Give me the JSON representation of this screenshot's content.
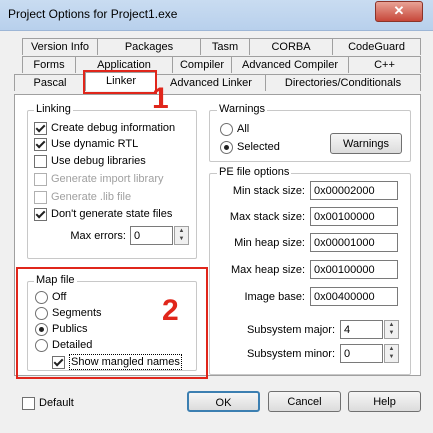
{
  "window": {
    "title": "Project Options for Project1.exe",
    "close_symbol": "✕"
  },
  "tabs": {
    "row1": [
      "Version Info",
      "Packages",
      "Tasm",
      "CORBA",
      "CodeGuard"
    ],
    "row2": [
      "Forms",
      "Application",
      "Compiler",
      "Advanced Compiler",
      "C++"
    ],
    "row3": [
      "Pascal",
      "Linker",
      "Advanced Linker",
      "Directories/Conditionals"
    ],
    "active": "Linker"
  },
  "linking": {
    "title": "Linking",
    "options": [
      {
        "label": "Create debug information",
        "checked": true,
        "enabled": true
      },
      {
        "label": "Use dynamic RTL",
        "checked": true,
        "enabled": true
      },
      {
        "label": "Use debug libraries",
        "checked": false,
        "enabled": true
      },
      {
        "label": "Generate import library",
        "checked": false,
        "enabled": false
      },
      {
        "label": "Generate .lib file",
        "checked": false,
        "enabled": false
      },
      {
        "label": "Don't generate state files",
        "checked": true,
        "enabled": true
      }
    ],
    "max_errors_label": "Max errors:",
    "max_errors_value": "0"
  },
  "warnings": {
    "title": "Warnings",
    "options": [
      {
        "label": "All",
        "selected": false
      },
      {
        "label": "Selected",
        "selected": true
      }
    ],
    "button": "Warnings"
  },
  "pe_file_options": {
    "title": "PE file options",
    "fields": [
      {
        "label": "Min stack size:",
        "value": "0x00002000"
      },
      {
        "label": "Max stack size:",
        "value": "0x00100000"
      },
      {
        "label": "Min heap size:",
        "value": "0x00001000"
      },
      {
        "label": "Max heap size:",
        "value": "0x00100000"
      },
      {
        "label": "Image base:",
        "value": "0x00400000"
      }
    ],
    "subsystem_major_label": "Subsystem major:",
    "subsystem_major_value": "4",
    "subsystem_minor_label": "Subsystem minor:",
    "subsystem_minor_value": "0"
  },
  "map_file": {
    "title": "Map file",
    "options": [
      {
        "label": "Off",
        "selected": false
      },
      {
        "label": "Segments",
        "selected": false
      },
      {
        "label": "Publics",
        "selected": true
      },
      {
        "label": "Detailed",
        "selected": false
      }
    ],
    "show_mangled_label": "Show mangled names",
    "show_mangled_checked": true
  },
  "footer": {
    "default_label": "Default",
    "default_checked": false,
    "ok": "OK",
    "cancel": "Cancel",
    "help": "Help"
  },
  "annotations": {
    "one": "1",
    "two": "2",
    "color": "#e0261b"
  }
}
